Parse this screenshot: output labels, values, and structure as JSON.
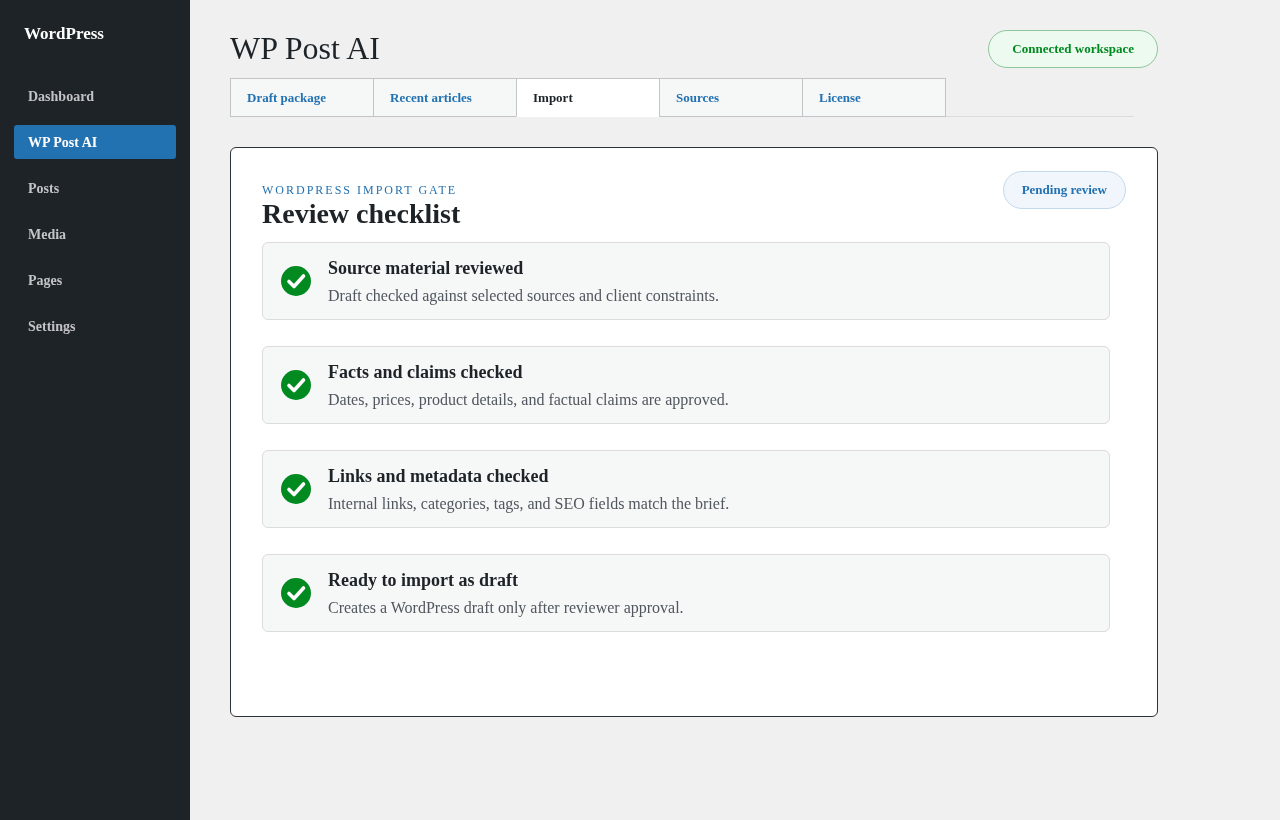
{
  "sidebar": {
    "brand": "WordPress",
    "items": [
      {
        "label": "Dashboard",
        "selected": false
      },
      {
        "label": "WP Post AI",
        "selected": true
      },
      {
        "label": "Posts",
        "selected": false
      },
      {
        "label": "Media",
        "selected": false
      },
      {
        "label": "Pages",
        "selected": false
      },
      {
        "label": "Settings",
        "selected": false
      }
    ]
  },
  "header": {
    "title": "WP Post AI",
    "status_badge": "Connected workspace"
  },
  "tabs": [
    {
      "label": "Draft package",
      "selected": false
    },
    {
      "label": "Recent articles",
      "selected": false
    },
    {
      "label": "Import",
      "selected": true
    },
    {
      "label": "Sources",
      "selected": false
    },
    {
      "label": "License",
      "selected": false
    }
  ],
  "panel": {
    "eyebrow": "WORDPRESS IMPORT GATE",
    "title": "Review checklist",
    "status_badge": "Pending review",
    "checklist": [
      {
        "title": "Source material reviewed",
        "description": "Draft checked against selected sources and client constraints.",
        "checked": true
      },
      {
        "title": "Facts and claims checked",
        "description": "Dates, prices, product details, and factual claims are approved.",
        "checked": true
      },
      {
        "title": "Links and metadata checked",
        "description": "Internal links, categories, tags, and SEO fields match the brief.",
        "checked": true
      },
      {
        "title": "Ready to import as draft",
        "description": "Creates a WordPress draft only after reviewer approval.",
        "checked": true
      }
    ]
  }
}
